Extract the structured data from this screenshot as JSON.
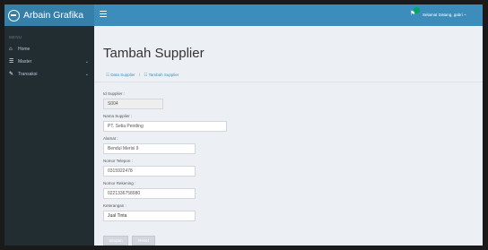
{
  "brand": {
    "name": "Arbain Grafika"
  },
  "sidebar": {
    "header": "MENU",
    "items": [
      {
        "label": "Home",
        "icon": "home-icon"
      },
      {
        "label": "Master",
        "icon": "table-icon"
      },
      {
        "label": "Transaksi",
        "icon": "edit-icon"
      }
    ]
  },
  "topbar": {
    "welcome": "Selamat Datang, gabri ~"
  },
  "page": {
    "title": "Tambah Supplier"
  },
  "breadcrumb": {
    "item1": "Data Supplier",
    "sep": "/",
    "item2": "Tambah Supplier"
  },
  "form": {
    "id_label": "Id Supplier :",
    "id_value": "S004",
    "nama_label": "Nama Supplier :",
    "nama_value": "PT. Setia Pending",
    "alamat_label": "Alamat :",
    "alamat_value": "Bendul Merisi 9",
    "telp_label": "Nomor Telepon :",
    "telp_value": "0315922478",
    "rek_label": "Nomor Rekening :",
    "rek_value": "0221336758980",
    "ket_label": "Keterangan :",
    "ket_value": "Jual Tinta"
  },
  "buttons": {
    "save": "Simpan",
    "reset": "Reset"
  }
}
